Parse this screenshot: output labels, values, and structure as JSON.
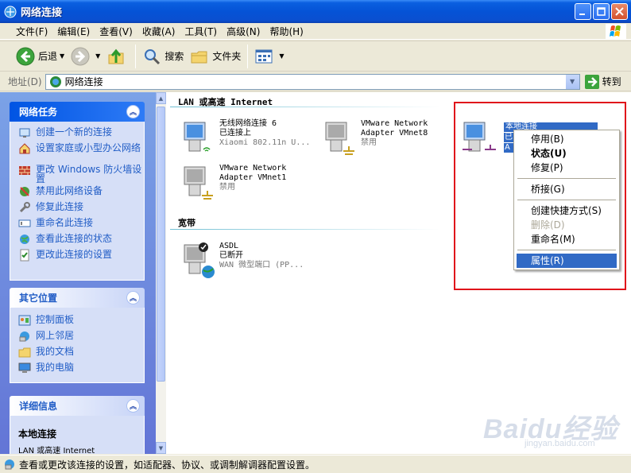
{
  "window": {
    "title": "网络连接"
  },
  "menu": [
    "文件(F)",
    "编辑(E)",
    "查看(V)",
    "收藏(A)",
    "工具(T)",
    "高级(N)",
    "帮助(H)"
  ],
  "toolbar": {
    "back": "后退",
    "search": "搜索",
    "folders": "文件夹"
  },
  "address": {
    "label": "地址(D)",
    "value": "网络连接",
    "go": "转到"
  },
  "tasks_panel": {
    "title": "网络任务",
    "items": [
      "创建一个新的连接",
      "设置家庭或小型办公网络",
      "更改 Windows 防火墙设置",
      "禁用此网络设备",
      "修复此连接",
      "重命名此连接",
      "查看此连接的状态",
      "更改此连接的设置"
    ]
  },
  "places_panel": {
    "title": "其它位置",
    "items": [
      "控制面板",
      "网上邻居",
      "我的文档",
      "我的电脑"
    ]
  },
  "details_panel": {
    "title": "详细信息",
    "name": "本地连接",
    "type": "LAN 或高速 Internet"
  },
  "groups": {
    "lan": "LAN 或高速 Internet",
    "broadband": "宽带"
  },
  "connections": [
    {
      "name": "无线网络连接 6",
      "status": "已连接上",
      "device": "Xiaomi 802.11n U..."
    },
    {
      "name": "VMware Network Adapter VMnet8",
      "status": "禁用",
      "device": ""
    },
    {
      "name": "VMware Network Adapter VMnet1",
      "status": "禁用",
      "device": ""
    },
    {
      "name": "ASDL",
      "status": "已断开",
      "device": "WAN 微型端口 (PP..."
    }
  ],
  "selected_connection": {
    "name": "本地连接",
    "status_partial": "已",
    "device_partial": "A"
  },
  "context_menu": [
    {
      "label": "停用(B)",
      "style": "normal"
    },
    {
      "label": "状态(U)",
      "style": "bold"
    },
    {
      "label": "修复(P)",
      "style": "normal"
    },
    {
      "label": "桥接(G)",
      "style": "normal"
    },
    {
      "label": "创建快捷方式(S)",
      "style": "normal"
    },
    {
      "label": "删除(D)",
      "style": "disabled"
    },
    {
      "label": "重命名(M)",
      "style": "normal"
    },
    {
      "label": "属性(R)",
      "style": "selected"
    }
  ],
  "status_bar": "查看或更改该连接的设置，如适配器、协议、或调制解调器配置设置。",
  "watermark": {
    "brand": "Baidu经验",
    "url": "jingyan.baidu.com"
  },
  "colors": {
    "title_blue": "#0553d6",
    "task_link": "#215dc6",
    "selection": "#316ac5",
    "highlight_red": "#e0141b"
  }
}
